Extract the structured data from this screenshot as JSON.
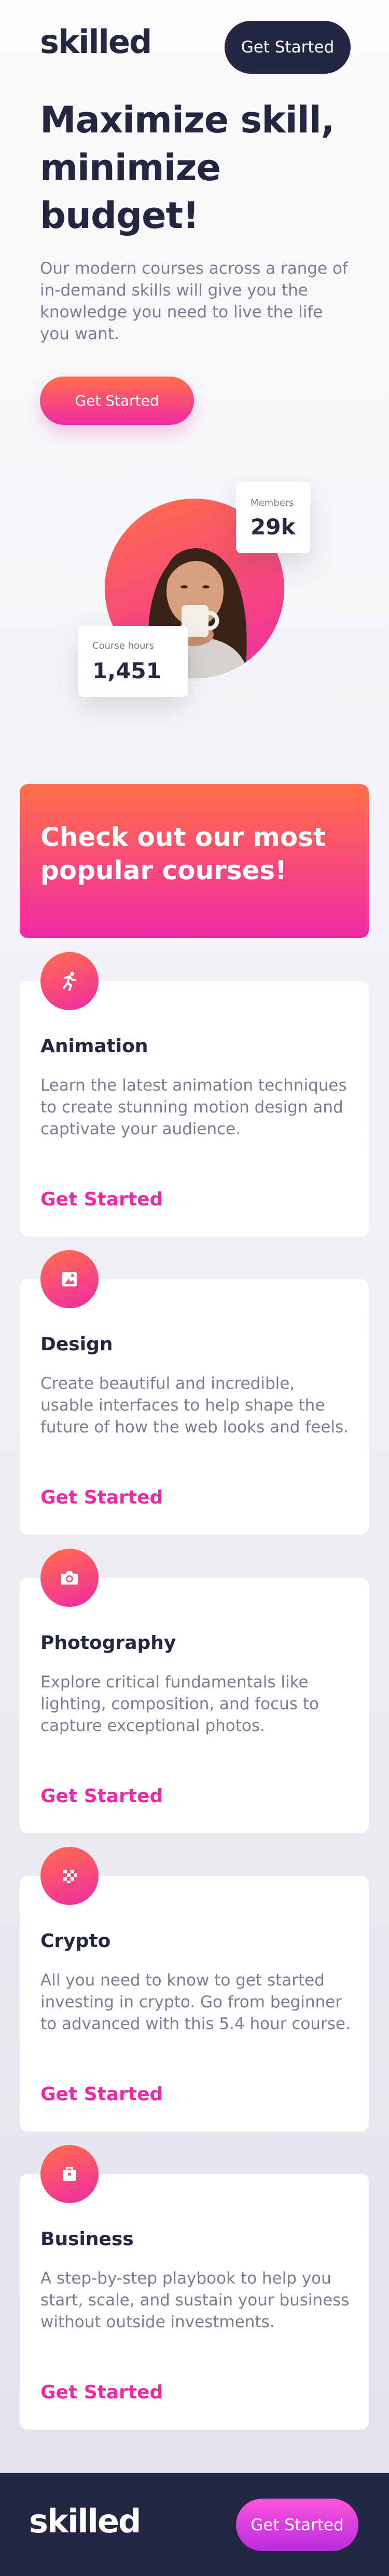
{
  "header": {
    "logo": "skilled",
    "cta_label": "Get Started"
  },
  "hero": {
    "title": "Maximize skill, minimize budget!",
    "description": "Our modern courses across a range of in-demand skills will give you the knowledge you need to live the life you want.",
    "cta_label": "Get Started",
    "stats": {
      "members_label": "Members",
      "members_value": "29k",
      "hours_label": "Course hours",
      "hours_value": "1,451"
    }
  },
  "popular": {
    "title": "Check out our most popular courses!"
  },
  "courses": [
    {
      "icon": "running-person-icon",
      "title": "Animation",
      "description": "Learn the latest animation techniques to create stunning motion design and captivate your audience.",
      "link": "Get Started"
    },
    {
      "icon": "image-frame-icon",
      "title": "Design",
      "description": "Create beautiful and incredible, usable interfaces to help shape the future of how the web looks and feels.",
      "link": "Get Started"
    },
    {
      "icon": "camera-icon",
      "title": "Photography",
      "description": "Explore critical fundamentals like lighting, composition, and focus to capture exceptional photos.",
      "link": "Get Started"
    },
    {
      "icon": "crypto-grid-icon",
      "title": "Crypto",
      "description": "All you need to know to get started investing in crypto. Go from beginner to advanced with this 5.4 hour course.",
      "link": "Get Started"
    },
    {
      "icon": "briefcase-icon",
      "title": "Business",
      "description": "A step-by-step playbook to help you start, scale, and sustain your business without outside investments.",
      "link": "Get Started"
    }
  ],
  "footer": {
    "logo": "skilled",
    "cta_label": "Get Started"
  },
  "colors": {
    "dark": "#242742",
    "accent_pink": "#f02aa6",
    "accent_orange": "#ff6f48",
    "muted_text": "#7a7d93"
  }
}
